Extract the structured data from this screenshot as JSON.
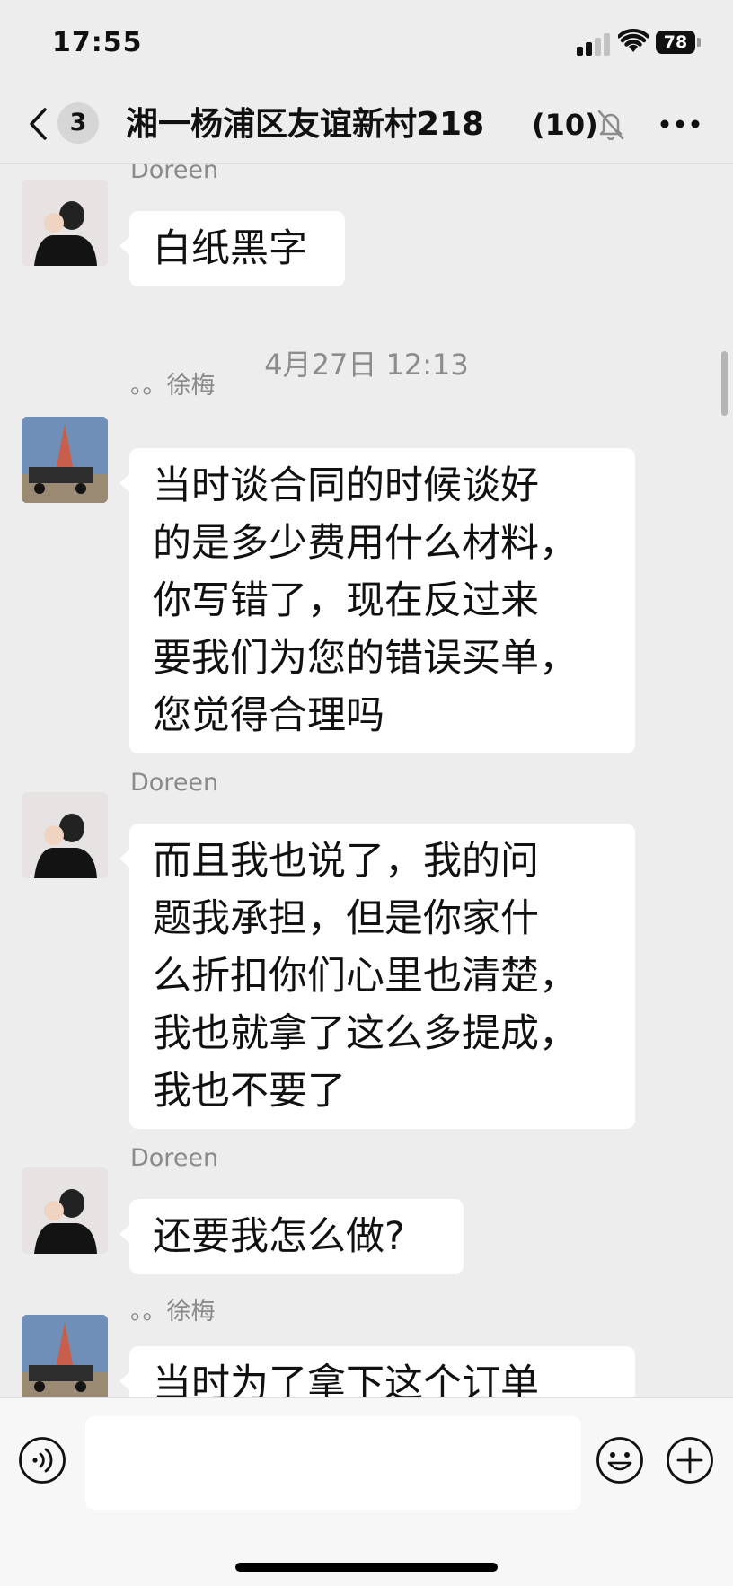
{
  "status_bar": {
    "time": "17:55",
    "battery": "78"
  },
  "nav": {
    "unread_count": "3",
    "title": "湘一杨浦区友谊新村218",
    "member_count": "(10)"
  },
  "messages": [
    {
      "sender": "Doreen",
      "lines": [
        "白纸黑字"
      ]
    },
    {
      "timestamp": "4月27日 12:13"
    },
    {
      "sender": "。。徐梅",
      "lines": [
        "当时谈合同的时候谈好",
        "的是多少费用什么材料，",
        "你写错了，现在反过来",
        "要我们为您的错误买单，",
        "您觉得合理吗"
      ]
    },
    {
      "sender": "Doreen",
      "lines": [
        "而且我也说了，我的问",
        "题我承担，但是你家什",
        "么折扣你们心里也清楚，",
        "我也就拿了这么多提成，",
        "我也不要了"
      ]
    },
    {
      "sender": "Doreen",
      "lines": [
        "还要我怎么做?"
      ]
    },
    {
      "sender": "。。徐梅",
      "lines": [
        "当时为了拿下这个订单"
      ]
    }
  ],
  "input": {
    "placeholder": ""
  },
  "icons": {
    "back": "chevron-left-icon",
    "mute": "bell-slash-icon",
    "more": "ellipsis-icon",
    "voice": "voice-icon",
    "emoji": "smiley-icon",
    "plus": "plus-circle-icon"
  },
  "colors": {
    "background": "#ededed",
    "bubble": "#ffffff",
    "meta_text": "#8a8a8a"
  }
}
